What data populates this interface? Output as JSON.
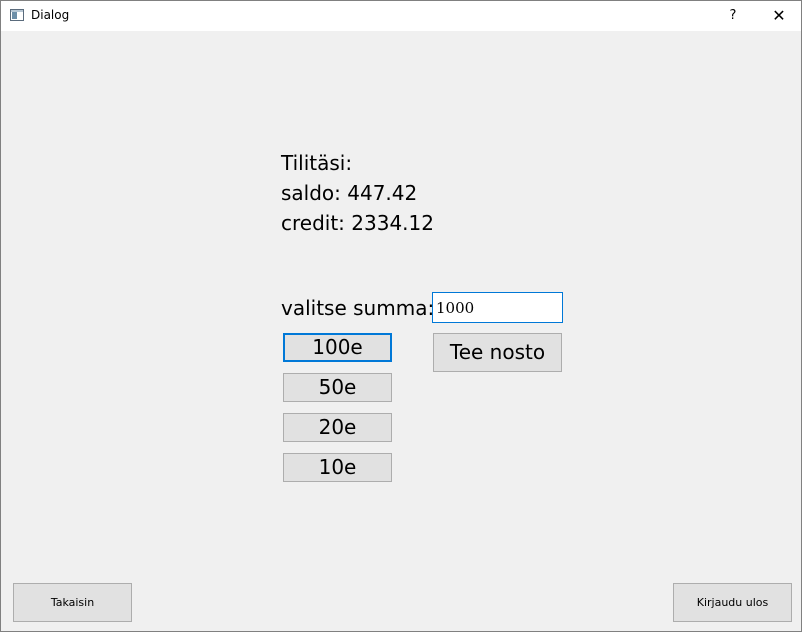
{
  "window": {
    "title": "Dialog",
    "help_label": "?",
    "close_label": "✕"
  },
  "account": {
    "heading": "Tilitäsi:",
    "balance_text": "saldo: 447.42",
    "credit_text": "credit: 2334.12"
  },
  "withdraw": {
    "amount_label": "valitse summa:",
    "amount_value": "1000",
    "quick_amounts": [
      "100e",
      "50e",
      "20e",
      "10e"
    ],
    "submit_label": "Tee nosto"
  },
  "footer": {
    "back_label": "Takaisin",
    "logout_label": "Kirjaudu ulos"
  },
  "colors": {
    "window_bg": "#f0f0f0",
    "button_bg": "#e1e1e1",
    "focus_accent": "#0078d7"
  },
  "icons": {
    "app": "app-window-icon",
    "close": "close-icon",
    "help": "help-icon"
  }
}
